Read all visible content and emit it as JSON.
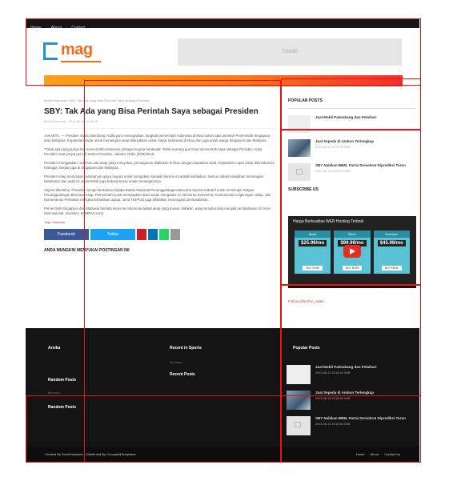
{
  "topnav": {
    "items": [
      "Home",
      "About",
      "Contact"
    ]
  },
  "header": {
    "logo_text": "mag",
    "banner_text": "728x90"
  },
  "article": {
    "breadcrumb": "Berita Nasional ▸ SBY: Tak Ada yang Bisa Perintah Saya sebagai Presiden",
    "title": "SBY: Tak Ada yang Bisa Perintah Saya sebagai Presiden",
    "meta": "Berita Nasional · 2013-06-26 09:16:00",
    "paragraphs": [
      "JAKARTA, — Presiden Susilo Bambang Yudhoyono menegaskan, langkah pemerintah Indonesia di Riau bukan atas perintah Pemerintah Singapura atau Malaysia. Kepatuhan cepat untuk menangani asap ditunjukkan untuk rakyat Indonesia di Riau dan juga untuk warga Singapura dan Malaysia.",
      "\"Tidak ada yang punya hak memerintah Indonesia sebagai negara berdaulat. Tidak seorang pun bisa memerintah saya sebagai Presiden. Kata Presiden saat jumpa pers di Kantor Presiden, Jakarta, Rabu (26/6/2013).",
      "Presiden mengatakan, sebelum ada asap yang menyebar, penanganan dilakukan di Riau dengan kapasitas awal. Kepatuhan cepat untuk dikirimkan ke tetangga. Begitu juga di Singapura dan Malaysia.",
      "Presiden tetap menyadari pentingnya upaya negara untuk mengatasi masalah karena ini adalah kebijakan. Namun dalam kewajiban menangani kebakaran dan asap ini, pemerintah juga bekerja keras untuk menanganinya.",
      "Seperti diketahui, Presiden menginstruksikan Kepala Badan Nasional Penanggulangan Bencana Syamsul Maarif untuk memimpin Satgas Penanggulangan Bencana Asap. Pemerintah pusat menyiapkan dana untuk mengatasi ini. Bersama Kemenhut, Kementerian Lingkungan Hidup, dan Kementerian Pertanian mengkoordinasikan upaya, serta TNI/Polri juga dilibatkan menangani permasalahan.",
      "Pemerintah Singapura dan Malaysia berkata keras ke Indonesia akibat asap yang masuk. Bahkan, asap tersebut bisa menjadi pembahasan di forum internasional. (Sumber: KOMPAS.com)"
    ],
    "tags_label": "Tags:",
    "tag": "Nasional",
    "share": [
      "Facebook",
      "Twitter",
      "",
      "",
      "",
      ""
    ],
    "related": "ANDA MUNGKIN MENYUKAI POSTINGAN INI"
  },
  "sidebar": {
    "popular_title": "POPULAR POSTS",
    "posts": [
      {
        "title": "Jual Mobil Palembang dan Pelaihari",
        "date": ""
      },
      {
        "title": "Jual Sepeda di Ambon Terlengkap",
        "date": "2013-06-13 23:22:00 WIB"
      },
      {
        "title": "SBY Naikkan BBM, Partai Demokrat Diprediksi Turun",
        "date": "2013-06-13 23:22:00 WIB"
      }
    ],
    "subscribe_title": "SUBSCRIBE US",
    "video": {
      "title": "Harga Berkualitas WEB Hosting Terbaik",
      "plans": [
        {
          "name": "Basic",
          "price": "$25.99/mo",
          "button": "BUY NOW"
        },
        {
          "name": "Silver",
          "price": "$99.99/mo",
          "button": "BUY NOW"
        },
        {
          "name": "Premium",
          "price": "$45.99/mo",
          "button": "BUY NOW"
        }
      ]
    },
    "follow": "Follow @techtv_rotate"
  },
  "footer": {
    "col1_title": "Arsika",
    "col1_random": "Random Posts",
    "col1_sub": "Memuat…",
    "col1_random2": "Random Posts",
    "col2_title": "Recent in Sports",
    "col2_sub": "Memuat…",
    "col2_recent": "Recent Posts",
    "col3_title": "Popular Posts",
    "posts": [
      {
        "title": "Jual Mobil Palembang dan Pelaihari",
        "date": "2013-06-13 23:22:00 WIB"
      },
      {
        "title": "Jual Sepeda di Ambon Terlengkap",
        "date": "2013-06-13 23:22:00 WIB"
      },
      {
        "title": "SBY Naikkan BBM, Partai Demokrat Diprediksi Turun",
        "date": "2013-06-13 23:22:00 WIB"
      }
    ]
  },
  "bottom": {
    "credit": "Created By SoraTemplates | Distributed By: GooyaabiTemplates",
    "links": [
      "Home",
      "About",
      "Contact Us"
    ]
  },
  "colors": {
    "accent": "#ef6b1f",
    "brand_blue": "#2a8fd6",
    "facebook": "#3b5998",
    "twitter": "#1da1f2",
    "highlight": "#e11111"
  }
}
